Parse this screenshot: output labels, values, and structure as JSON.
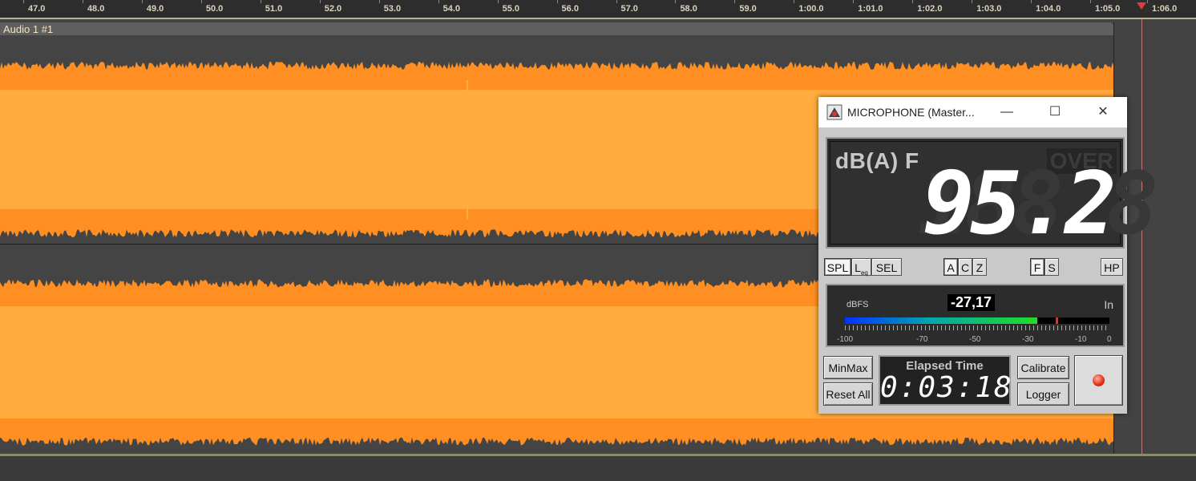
{
  "timeline": {
    "ticks": [
      "47.0",
      "48.0",
      "49.0",
      "50.0",
      "51.0",
      "52.0",
      "53.0",
      "54.0",
      "55.0",
      "56.0",
      "57.0",
      "58.0",
      "59.0",
      "1:00.0",
      "1:01.0",
      "1:02.0",
      "1:03.0",
      "1:04.0",
      "1:05.0",
      "1:06.0"
    ]
  },
  "track": {
    "name": "Audio 1 #1",
    "waveform_color": "#ffab3d",
    "waveform_edge_color": "#ff8f22"
  },
  "meter_window": {
    "title": "MICROPHONE (Master...",
    "controls": {
      "minimize": "—",
      "maximize": "☐",
      "close": "✕"
    },
    "display": {
      "weighting": "dB(A) F",
      "over": "OVER",
      "value": "95.2",
      "ghost": "188.8"
    },
    "mode_buttons": {
      "spl": "SPL",
      "leq_main": "L",
      "leq_sub": "eq",
      "sel": "SEL"
    },
    "weighting_buttons": {
      "a": "A",
      "c": "C",
      "z": "Z"
    },
    "speed_buttons": {
      "f": "F",
      "s": "S"
    },
    "hp_button": "HP",
    "level": {
      "unit": "dBFS",
      "value": "-27,17",
      "input": "In",
      "min": -100,
      "max": 0,
      "current": -27.17,
      "peak": -20,
      "scale": [
        "-100",
        "-70",
        "-50",
        "-30",
        "-10",
        "0"
      ]
    },
    "buttons": {
      "minmax": "MinMax",
      "reset_all": "Reset All",
      "calibrate": "Calibrate",
      "logger": "Logger"
    },
    "elapsed": {
      "label": "Elapsed Time",
      "value": "0:03:18"
    }
  }
}
